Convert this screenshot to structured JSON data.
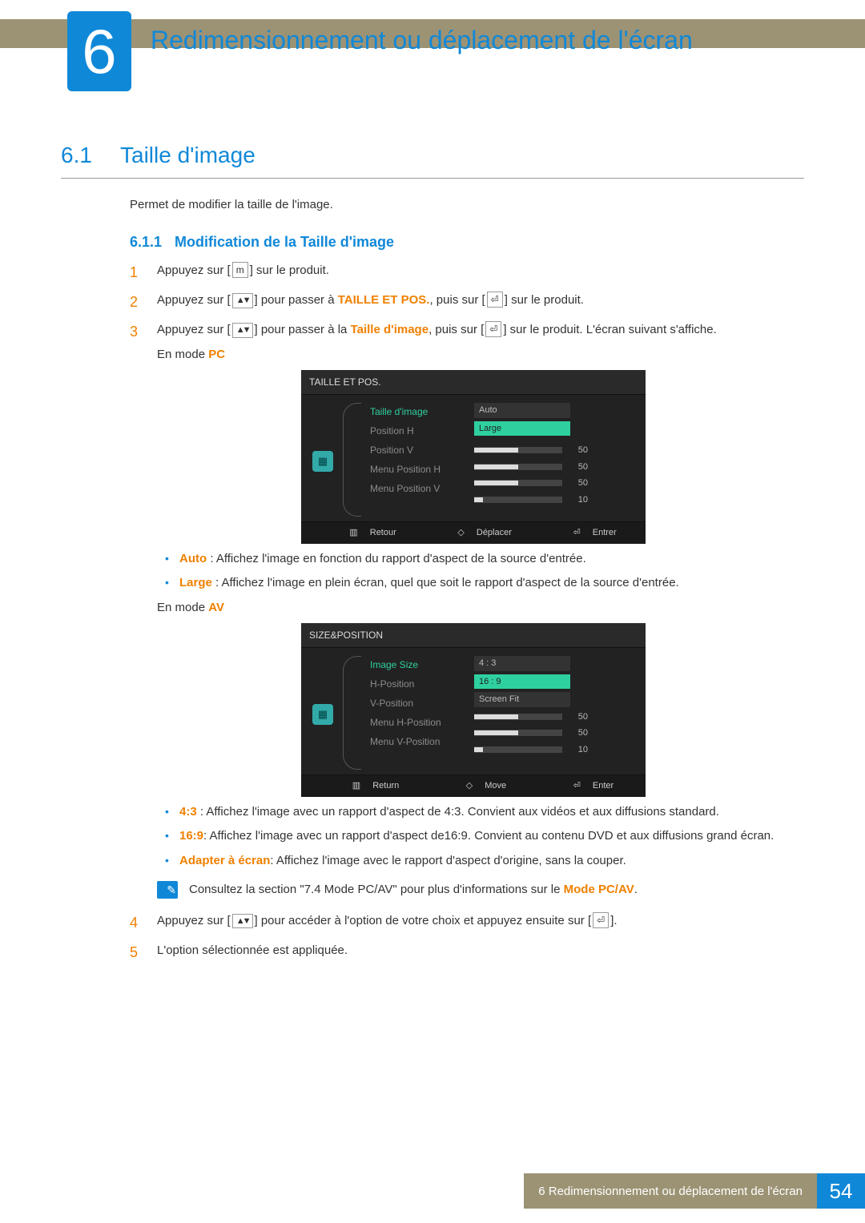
{
  "chapter": {
    "number": "6",
    "title": "Redimensionnement ou déplacement de l'écran"
  },
  "section": {
    "number": "6.1",
    "title": "Taille d'image",
    "intro": "Permet de modifier la taille de l'image."
  },
  "subsection": {
    "number": "6.1.1",
    "title": "Modification de la Taille d'image"
  },
  "steps": {
    "s1": {
      "num": "1",
      "t1": "Appuyez sur [",
      "btn": "m",
      "t2": "] sur le produit."
    },
    "s2": {
      "num": "2",
      "t1": "Appuyez sur [",
      "t2": "] pour passer à ",
      "orange": "TAILLE ET POS.",
      "t3": ", puis sur [",
      "t4": "] sur le produit."
    },
    "s3": {
      "num": "3",
      "t1": "Appuyez sur [",
      "t2": "] pour passer à la ",
      "orange": "Taille d'image",
      "t3": ", puis sur [",
      "t4": "] sur le produit. L'écran suivant s'affiche.",
      "mode_pc_pre": "En mode ",
      "mode_pc": "PC",
      "mode_av_pre": "En mode ",
      "mode_av": "AV"
    },
    "s4": {
      "num": "4",
      "t1": "Appuyez sur [",
      "t2": "] pour accéder à l'option de votre choix et appuyez ensuite sur [",
      "t3": "]."
    },
    "s5": {
      "num": "5",
      "t1": "L'option sélectionnée est appliquée."
    }
  },
  "osd_pc": {
    "title": "TAILLE ET POS.",
    "items": [
      "Taille d'image",
      "Position H",
      "Position V",
      "Menu Position H",
      "Menu Position V"
    ],
    "opts": [
      "Auto",
      "Large"
    ],
    "sliders": [
      50,
      50,
      50,
      10
    ],
    "footer": [
      "Retour",
      "Déplacer",
      "Entrer"
    ]
  },
  "osd_av": {
    "title": "SIZE&POSITION",
    "items": [
      "Image Size",
      "H-Position",
      "V-Position",
      "Menu H-Position",
      "Menu V-Position"
    ],
    "opts": [
      "4 : 3",
      "16 : 9",
      "Screen Fit"
    ],
    "sliders": [
      50,
      50,
      10
    ],
    "footer": [
      "Return",
      "Move",
      "Enter"
    ]
  },
  "bullets_pc": {
    "auto": {
      "label": "Auto",
      "text": " : Affichez l'image en fonction du rapport d'aspect de la source d'entrée."
    },
    "large": {
      "label": "Large",
      "text": " : Affichez l'image en plein écran, quel que soit le rapport d'aspect de la source d'entrée."
    }
  },
  "bullets_av": {
    "r43": {
      "label": "4:3",
      "text": " : Affichez l'image avec un rapport d'aspect de 4:3. Convient aux vidéos et aux diffusions standard."
    },
    "r169": {
      "label": "16:9",
      "text": ": Affichez l'image avec un rapport d'aspect de16:9. Convient au contenu DVD et aux diffusions grand écran."
    },
    "fit": {
      "label": "Adapter à écran",
      "text": ": Affichez l'image avec le rapport d'aspect d'origine, sans la couper."
    }
  },
  "note": {
    "t1": "Consultez la section \"7.4 Mode PC/AV\" pour plus d'informations sur le ",
    "orange": "Mode PC/AV",
    "t2": "."
  },
  "footer": {
    "label": "6 Redimensionnement ou déplacement de l'écran",
    "page": "54"
  },
  "icons": {
    "updown": "▲▼",
    "enter": "⏎",
    "menu": "▥",
    "move": "◇"
  }
}
